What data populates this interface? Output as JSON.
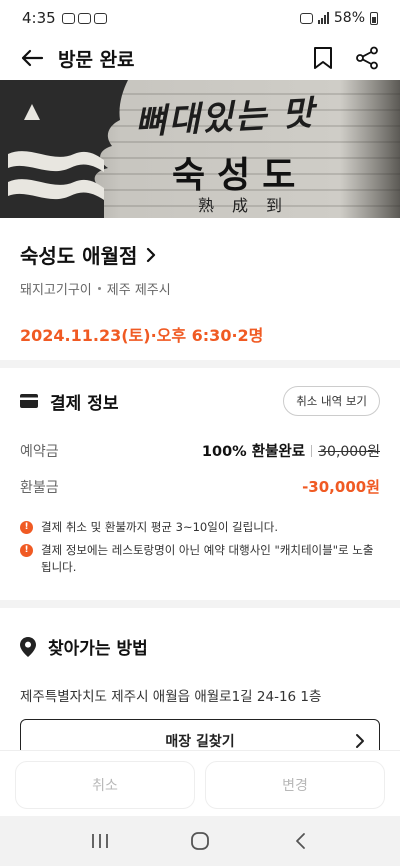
{
  "status_bar": {
    "time": "4:35",
    "battery": "58%"
  },
  "header": {
    "title": "방문 완료"
  },
  "hero": {
    "sign_slogan": "뼈대있는 맛",
    "sign_name": "숙성도",
    "sign_hanja": "熟成到"
  },
  "store": {
    "name": "숙성도 애월점",
    "category": "돼지고기구이",
    "location": "제주 제주시",
    "visit_datetime": "2024.11.23(토)·오후 6:30·2명"
  },
  "payment": {
    "title": "결제 정보",
    "cancel_history_button": "취소 내역 보기",
    "reservation_label": "예약금",
    "reservation_status": "100% 환불완료",
    "reservation_amount": "30,000원",
    "refund_label": "환불금",
    "refund_amount": "-30,000원",
    "notes": [
      "결제 취소 및 환불까지 평균 3~10일이 길립니다.",
      "결제 정보에는 레스토랑명이 아닌 예약 대행사인 \"캐치테이블\"로 노출됩니다."
    ]
  },
  "directions": {
    "title": "찾아가는 방법",
    "address": "제주특별자치도 제주시 애월읍 애월로1길 24-16 1층",
    "route_button": "매장 길찾기"
  },
  "actions": {
    "cancel": "취소",
    "change": "변경"
  },
  "colors": {
    "accent": "#f05a23",
    "divider": "#f3f3f3",
    "disabled_text": "#b8b8b8"
  }
}
